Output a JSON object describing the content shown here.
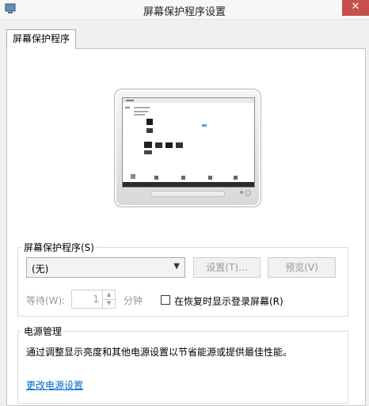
{
  "window": {
    "title": "屏幕保护程序设置",
    "close_label": "✕"
  },
  "tab": {
    "label": "屏幕保护程序"
  },
  "screensaver": {
    "group_label": "屏幕保护程序(S)",
    "selected": "(无)",
    "settings_button": "设置(T)...",
    "preview_button": "预览(V)",
    "wait_label": "等待(W):",
    "wait_value": "1",
    "minutes_label": "分钟",
    "resume_checkbox_label": "在恢复时显示登录屏幕(R)",
    "resume_checked": false
  },
  "power": {
    "group_label": "电源管理",
    "description": "通过调整显示亮度和其他电源设置以节省能源或提供最佳性能。",
    "link": "更改电源设置"
  },
  "icons": {
    "app": "screensaver-monitor-icon",
    "close": "close-icon",
    "dropdown": "chevron-down-icon",
    "spin_up": "spin-up-arrow-icon",
    "spin_down": "spin-down-arrow-icon"
  },
  "colors": {
    "close_bg": "#c7504c",
    "link": "#0066cc"
  }
}
